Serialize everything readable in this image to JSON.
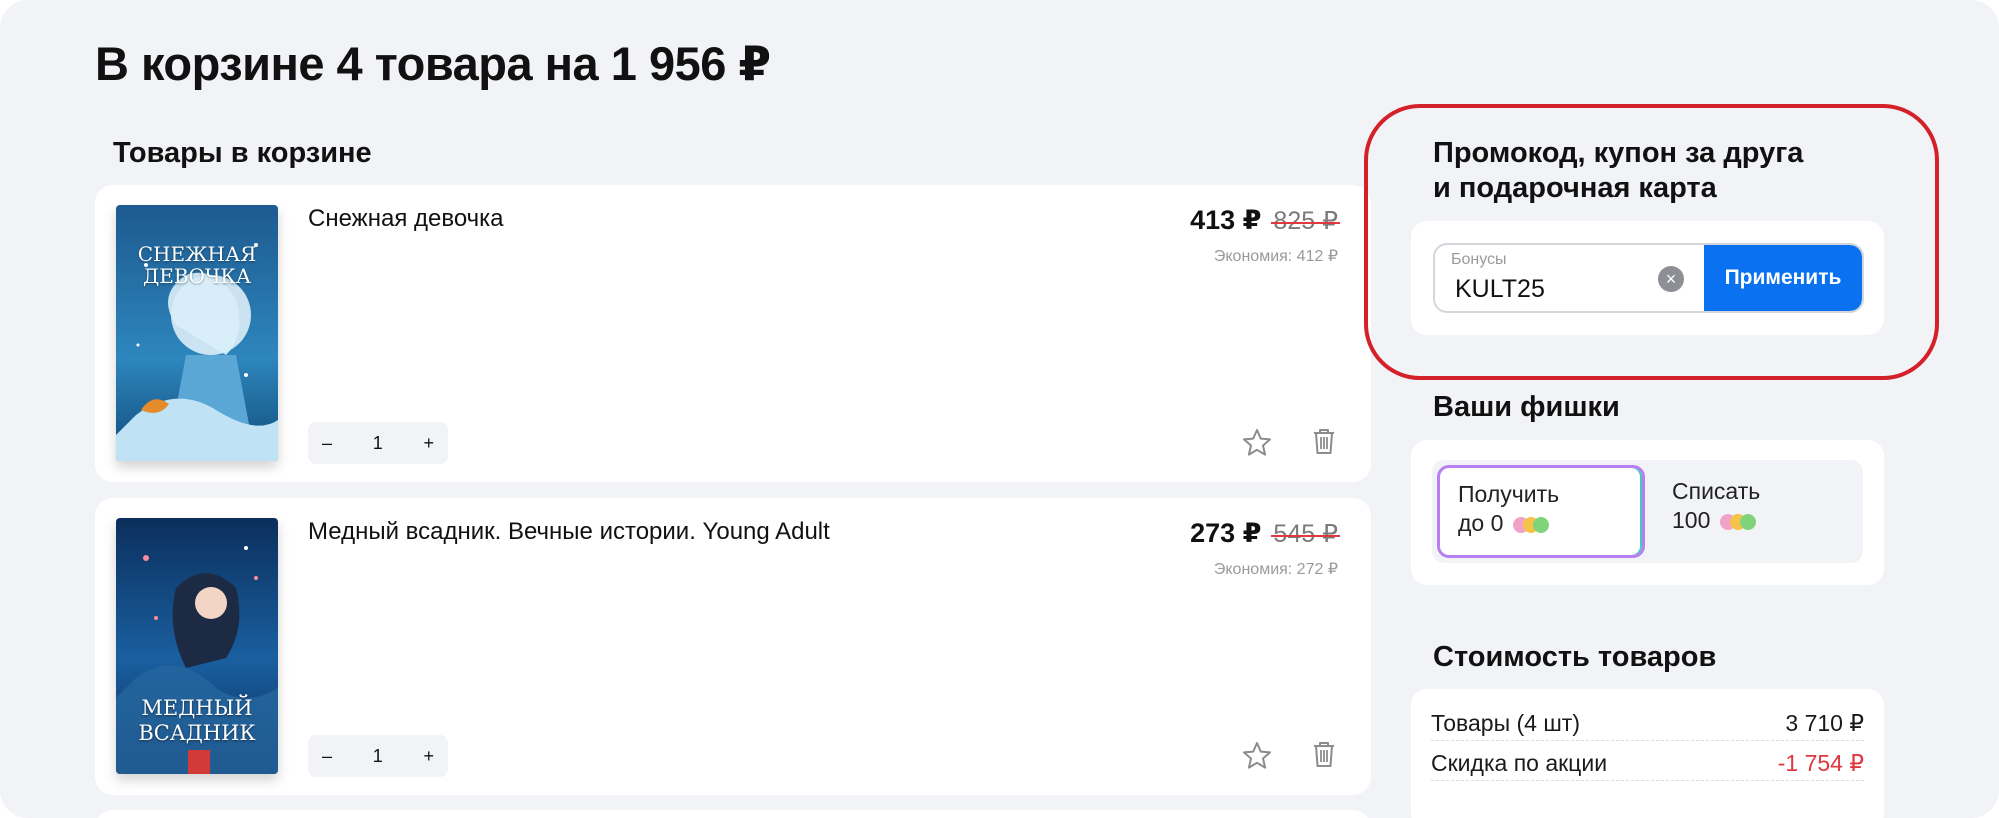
{
  "page_title": "В корзине 4 товара на 1 956 ₽",
  "cart": {
    "section_title": "Товары в корзине",
    "items": [
      {
        "title": "Снежная девочка",
        "cover_title": "СНЕЖНАЯ ДЕВОЧКА",
        "price": "413 ₽",
        "old_price": "825 ₽",
        "economy": "Экономия: 412 ₽",
        "qty_minus": "–",
        "qty": "1",
        "qty_plus": "+"
      },
      {
        "title": "Медный всадник. Вечные истории. Young Adult",
        "cover_title": "МЕДНЫЙ ВСАДНИК",
        "price": "273 ₽",
        "old_price": "545 ₽",
        "economy": "Экономия: 272 ₽",
        "qty_minus": "–",
        "qty": "1",
        "qty_plus": "+"
      }
    ]
  },
  "promo": {
    "title_line1": "Промокод, купон за друга",
    "title_line2": "и подарочная карта",
    "field_label": "Бонусы",
    "field_value": "KULT25",
    "clear_glyph": "×",
    "apply_label": "Применить",
    "highlight_color": "#d42029"
  },
  "chips": {
    "title": "Ваши фишки",
    "earn_line1": "Получить",
    "earn_line2": "до 0",
    "spend_line1": "Списать",
    "spend_line2": "100"
  },
  "summary": {
    "title": "Стоимость товаров",
    "rows": [
      {
        "label": "Товары (4 шт)",
        "value": "3 710 ₽"
      },
      {
        "label": "Скидка по акции",
        "value": "-1 754 ₽"
      }
    ]
  },
  "colors": {
    "accent": "#0a72f0",
    "discount": "#e0383e",
    "background": "#f2f3f6"
  },
  "icons": [
    "star-icon",
    "trash-icon",
    "clear-icon",
    "coin-icon"
  ]
}
